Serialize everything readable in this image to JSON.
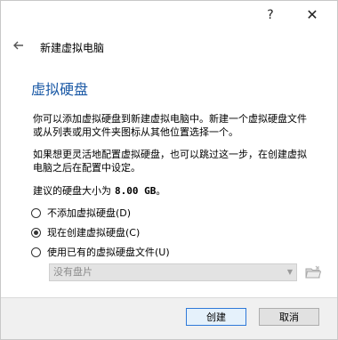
{
  "titlebar": {
    "help_label": "?",
    "close_label": "✕"
  },
  "nav": {
    "back_icon": "back-arrow-icon",
    "wizard_title": "新建虚拟电脑"
  },
  "page": {
    "heading": "虚拟硬盘",
    "paragraph1": "你可以添加虚拟硬盘到新建虚拟电脑中。新建一个虚拟硬盘文件或从列表或用文件夹图标从其他位置选择一个。",
    "paragraph2": "如果想更灵活地配置虚拟硬盘，也可以跳过这一步，在创建虚拟电脑之后在配置中设定。",
    "recommend_prefix": "建议的硬盘大小为",
    "recommend_size": "8.00 GB",
    "recommend_suffix": "。"
  },
  "options": [
    {
      "label": "不添加虚拟硬盘(D)",
      "checked": false
    },
    {
      "label": "现在创建虚拟硬盘(C)",
      "checked": true
    },
    {
      "label": "使用已有的虚拟硬盘文件(U)",
      "checked": false
    }
  ],
  "existing_disk": {
    "selected": "没有盘片",
    "folder_icon": "folder-open-icon"
  },
  "footer": {
    "create_label": "创建",
    "cancel_label": "取消"
  },
  "colors": {
    "heading": "#1c5aa6",
    "default_button_border": "#2f79d8"
  }
}
